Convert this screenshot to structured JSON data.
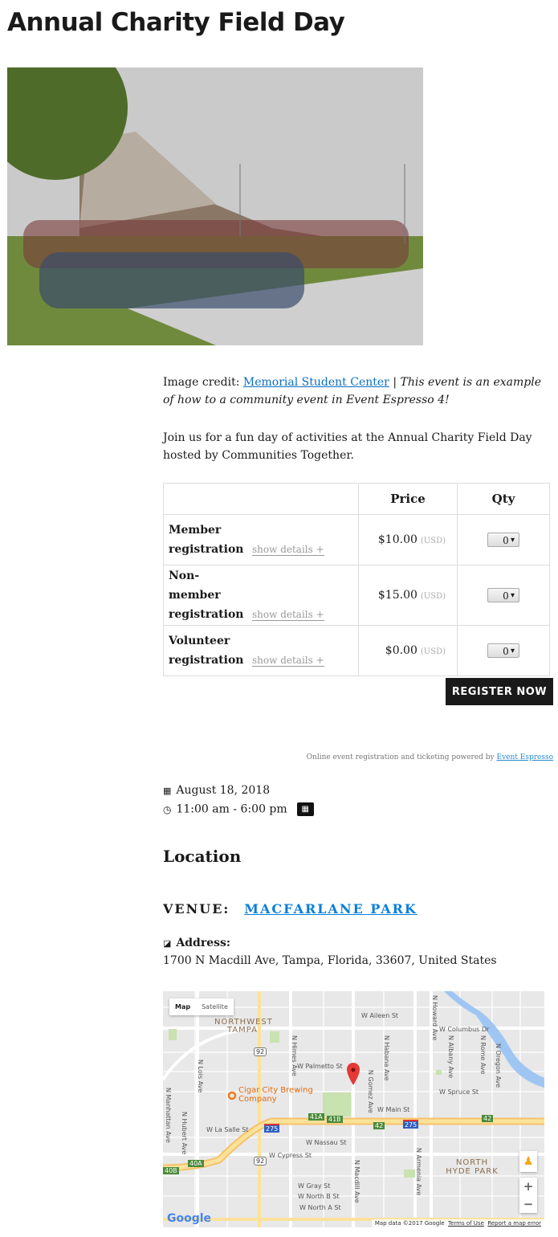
{
  "title": "Annual Charity Field Day",
  "credit": {
    "prefix": "Image credit: ",
    "link": "Memorial Student Center",
    "sep": " | ",
    "italic": "This event is an example of how to a community event in Event Espresso 4!"
  },
  "description": "Join us for a fun day of activities at the Annual Charity Field Day hosted by Communities Together.",
  "tickets": {
    "headers": [
      "",
      "Price",
      "Qty"
    ],
    "show_details": "show details +",
    "currency": "(USD)",
    "rows": [
      {
        "name": "Member registration",
        "price": "$10.00",
        "qty": "0"
      },
      {
        "name": "Non-member registration",
        "price": "$15.00",
        "qty": "0"
      },
      {
        "name": "Volunteer registration",
        "price": "$0.00",
        "qty": "0"
      }
    ]
  },
  "register_label": "REGISTER NOW",
  "powered": {
    "text": "Online event registration and ticketing powered by ",
    "link": "Event Espresso"
  },
  "date": "August 18, 2018",
  "time": "11:00 am - 6:00 pm",
  "location_heading": "Location",
  "venue": {
    "label": "VENUE:",
    "name": "MACFARLANE PARK"
  },
  "address": {
    "label": "Address:",
    "value": "1700 N Macdill Ave, Tampa, Florida, 33607, United States"
  },
  "map": {
    "tabs": [
      "Map",
      "Satellite"
    ],
    "places": [
      "NORTHWEST TAMPA",
      "Cigar City Brewing Company",
      "NORTH HYDE PARK"
    ],
    "streets": [
      "W Aileen St",
      "W Columbus Dr",
      "W Palmetto St",
      "W Spruce St",
      "W Main St",
      "W La Salle St",
      "W Nassau St",
      "W Cypress St",
      "W Gray St",
      "W North B St",
      "W North A St",
      "N Himes Ave",
      "N Macdill Ave",
      "N Howard Ave",
      "N Armenia Ave",
      "N Habana Ave",
      "N Gomez Ave",
      "N Albany Ave",
      "N Rome Ave",
      "N Oregon Ave",
      "N Lois Ave",
      "N Hubert Ave",
      "N Manhattan Ave"
    ],
    "shields": [
      "92",
      "92",
      "275",
      "275",
      "41A",
      "41B",
      "42",
      "42",
      "40A",
      "40B"
    ],
    "logo": "Google",
    "attribution": "Map data ©2017 Google",
    "terms": "Terms of Use",
    "report": "Report a map error",
    "zoom_in": "+",
    "zoom_out": "−"
  },
  "colors": {
    "link": "#0a6fc2",
    "button": "#1a1a1a",
    "pin": "#e53935"
  }
}
